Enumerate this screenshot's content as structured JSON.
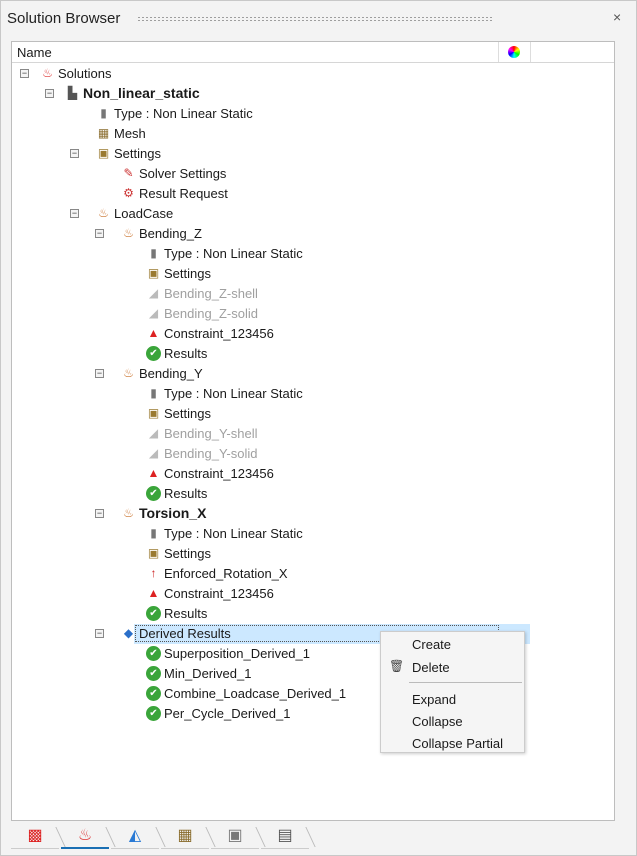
{
  "window": {
    "title": "Solution Browser",
    "close": "×"
  },
  "tree": {
    "column_name": "Name",
    "rows": [
      {
        "label": "Solutions",
        "level": 0,
        "expander": true,
        "icon": "solutions-icon"
      },
      {
        "label": "Non_linear_static",
        "level": 1,
        "expander": true,
        "bold": true,
        "icon": "solution-icon"
      },
      {
        "label": "Type : Non Linear Static",
        "level": 2,
        "icon": "type-icon"
      },
      {
        "label": "Mesh",
        "level": 2,
        "icon": "mesh-icon"
      },
      {
        "label": "Settings",
        "level": 2,
        "expander": true,
        "icon": "settings-icon"
      },
      {
        "label": "Solver Settings",
        "level": 3,
        "icon": "solver-settings-icon"
      },
      {
        "label": "Result Request",
        "level": 3,
        "icon": "result-request-icon"
      },
      {
        "label": "LoadCase",
        "level": 2,
        "expander": true,
        "icon": "loadcase-icon"
      },
      {
        "label": "Bending_Z",
        "level": 3,
        "expander": true,
        "icon": "loadcase-icon"
      },
      {
        "label": "Type : Non Linear Static",
        "level": 4,
        "icon": "type-icon"
      },
      {
        "label": "Settings",
        "level": 4,
        "icon": "settings-icon"
      },
      {
        "label": "Bending_Z-shell",
        "level": 4,
        "gray": true,
        "icon": "load-icon"
      },
      {
        "label": "Bending_Z-solid",
        "level": 4,
        "gray": true,
        "icon": "load-icon"
      },
      {
        "label": "Constraint_123456",
        "level": 4,
        "icon": "constraint-icon"
      },
      {
        "label": "Results",
        "level": 4,
        "icon": "results-icon"
      },
      {
        "label": "Bending_Y",
        "level": 3,
        "expander": true,
        "icon": "loadcase-icon"
      },
      {
        "label": "Type : Non Linear Static",
        "level": 4,
        "icon": "type-icon"
      },
      {
        "label": "Settings",
        "level": 4,
        "icon": "settings-icon"
      },
      {
        "label": "Bending_Y-shell",
        "level": 4,
        "gray": true,
        "icon": "load-icon"
      },
      {
        "label": "Bending_Y-solid",
        "level": 4,
        "gray": true,
        "icon": "load-icon"
      },
      {
        "label": "Constraint_123456",
        "level": 4,
        "icon": "constraint-icon"
      },
      {
        "label": "Results",
        "level": 4,
        "icon": "results-icon"
      },
      {
        "label": "Torsion_X",
        "level": 3,
        "expander": true,
        "bold": true,
        "icon": "loadcase-icon"
      },
      {
        "label": "Type : Non Linear Static",
        "level": 4,
        "icon": "type-icon"
      },
      {
        "label": "Settings",
        "level": 4,
        "icon": "settings-icon"
      },
      {
        "label": "Enforced_Rotation_X",
        "level": 4,
        "icon": "enforced-rotation-icon"
      },
      {
        "label": "Constraint_123456",
        "level": 4,
        "icon": "constraint-icon"
      },
      {
        "label": "Results",
        "level": 4,
        "icon": "results-icon"
      },
      {
        "label": "Derived Results",
        "level": 3,
        "expander": true,
        "selected": true,
        "icon": "derived-results-icon"
      },
      {
        "label": "Superposition_Derived_1",
        "level": 4,
        "icon": "results-icon"
      },
      {
        "label": "Min_Derived_1",
        "level": 4,
        "icon": "results-icon"
      },
      {
        "label": "Combine_Loadcase_Derived_1",
        "level": 4,
        "icon": "results-icon"
      },
      {
        "label": "Per_Cycle_Derived_1",
        "level": 4,
        "icon": "results-icon"
      }
    ]
  },
  "context_menu": {
    "items": [
      "Create",
      "Delete",
      "Expand",
      "Collapse",
      "Collapse Partial"
    ]
  },
  "bottom_tabs": [
    {
      "icon": "model-icon"
    },
    {
      "icon": "solutions-icon",
      "active": true
    },
    {
      "icon": "geometry-icon"
    },
    {
      "icon": "mesh-icon"
    },
    {
      "icon": "ai-icon"
    },
    {
      "icon": "script-icon"
    }
  ]
}
